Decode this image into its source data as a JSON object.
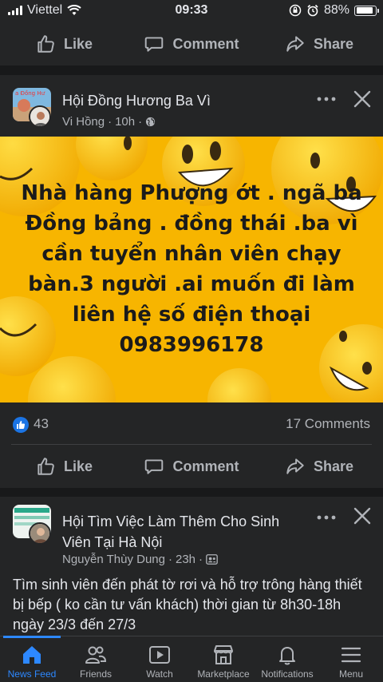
{
  "status_bar": {
    "carrier": "Viettel",
    "time": "09:33",
    "battery": "88%",
    "battery_level": 0.88
  },
  "top_actions": {
    "like": "Like",
    "comment": "Comment",
    "share": "Share"
  },
  "post1": {
    "group": "Hội Đồng Hương Ba Vì",
    "author": "Vi Hồng",
    "time": "10h",
    "image_text": "Nhà hàng Phượng ớt . ngã ba Đồng bảng . đồng thái .ba vì cần tuyển nhân viên chạy bàn.3 người .ai muốn đi làm liên hệ số điện thoại 0983996178",
    "like_count": "43",
    "comments": "17 Comments",
    "actions": {
      "like": "Like",
      "comment": "Comment",
      "share": "Share"
    }
  },
  "post2": {
    "group_line1": "Hội Tìm Việc Làm Thêm Cho Sinh",
    "group_line2": "Viên Tại Hà Nội",
    "author": "Nguyễn Thùy Dung",
    "time": "23h",
    "text": "Tìm sinh viên đến phát tờ rơi và hỗ trợ trông hàng thiết bị bếp  ( ko cần tư vấn khách) thời gian từ 8h30-18h ngày 23/3 đến 27/3"
  },
  "tab_bar": {
    "news_feed": "News Feed",
    "friends": "Friends",
    "watch": "Watch",
    "marketplace": "Marketplace",
    "notifications": "Notifications",
    "menu": "Menu"
  },
  "colors": {
    "accent": "#2d88ff",
    "background": "#18191a",
    "card": "#242526",
    "image_bg": "#f5b300"
  }
}
